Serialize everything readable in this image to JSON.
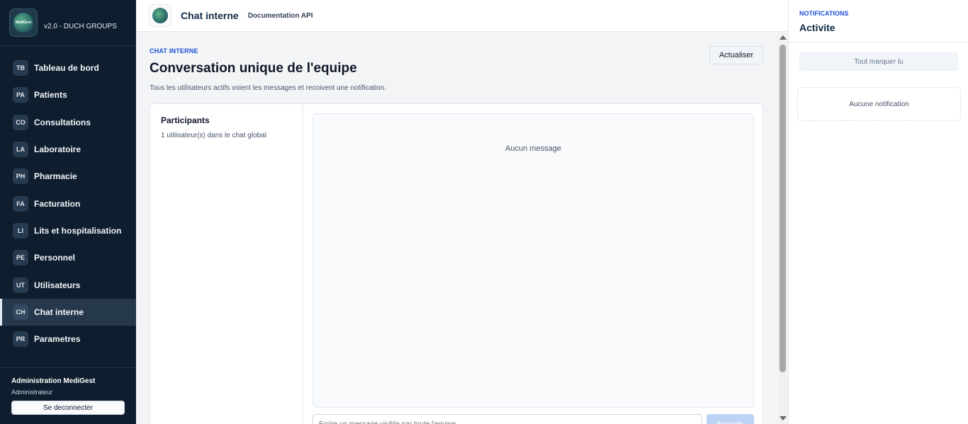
{
  "sidebar": {
    "logo_text": "MediGest",
    "version": "v2.0 - DUCH GROUPS",
    "items": [
      {
        "badge": "TB",
        "label": "Tableau de bord"
      },
      {
        "badge": "PA",
        "label": "Patients"
      },
      {
        "badge": "CO",
        "label": "Consultations"
      },
      {
        "badge": "LA",
        "label": "Laboratoire"
      },
      {
        "badge": "PH",
        "label": "Pharmacie"
      },
      {
        "badge": "FA",
        "label": "Facturation"
      },
      {
        "badge": "LI",
        "label": "Lits et hospitalisation"
      },
      {
        "badge": "PE",
        "label": "Personnel"
      },
      {
        "badge": "UT",
        "label": "Utilisateurs"
      },
      {
        "badge": "CH",
        "label": "Chat interne"
      },
      {
        "badge": "PR",
        "label": "Parametres"
      }
    ],
    "active_index": 9,
    "footer": {
      "user_name": "Administration MediGest",
      "user_role": "Administrateur",
      "logout_label": "Se deconnecter"
    }
  },
  "topbar": {
    "title": "Chat interne",
    "link": "Documentation API"
  },
  "main": {
    "eyebrow": "CHAT INTERNE",
    "title": "Conversation unique de l'equipe",
    "description": "Tous les utilisateurs actifs voient les messages et recoivent une notification.",
    "refresh_label": "Actualiser",
    "participants": {
      "title": "Participants",
      "count_text": "1 utilisateur(s) dans le chat global"
    },
    "messages": {
      "empty_text": "Aucun message"
    },
    "composer": {
      "placeholder": "Ecrire un message visible par toute l'equipe",
      "send_label": "Envoyer"
    }
  },
  "notifications": {
    "eyebrow": "NOTIFICATIONS",
    "title": "Activite",
    "mark_all_label": "Tout marquer lu",
    "empty_text": "Aucune notification"
  }
}
